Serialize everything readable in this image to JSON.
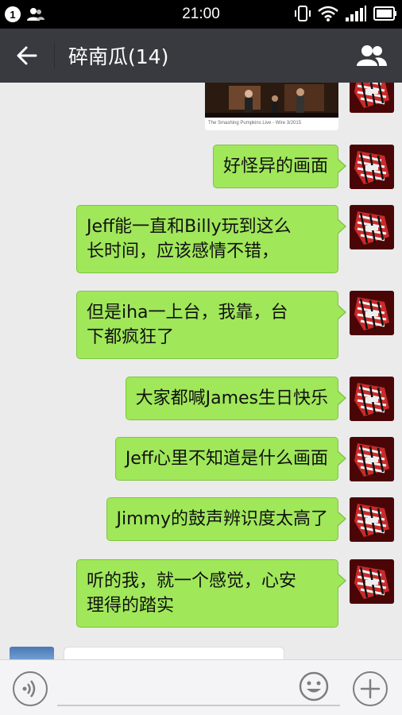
{
  "status_bar": {
    "notification_count": "1",
    "time": "21:00",
    "icons": [
      "notification-badge-icon",
      "contacts-icon",
      "vibrate-icon",
      "wifi-icon",
      "signal-icon",
      "battery-icon"
    ]
  },
  "header": {
    "back_icon": "arrow-left-icon",
    "title": "碎南瓜(14)",
    "members_icon": "group-members-icon"
  },
  "chat": {
    "image_message": {
      "caption": "The Smashing Pumpkins Live - Wire 3/2015"
    },
    "messages": [
      {
        "text_lines": [
          "好怪异的画面"
        ]
      },
      {
        "text_lines": [
          "Jeff能一直和Billy玩到这么",
          "长时间，应该感情不错，"
        ]
      },
      {
        "text_lines": [
          "但是iha一上台，我靠，台",
          "下都疯狂了"
        ]
      },
      {
        "text_lines": [
          "大家都喊James生日快乐"
        ]
      },
      {
        "text_lines": [
          "Jeff心里不知道是什么画面"
        ]
      },
      {
        "text_lines": [
          "Jimmy的鼓声辨识度太高了"
        ]
      },
      {
        "text_lines": [
          "听的我，就一个感觉，心安",
          "理得的踏实"
        ]
      }
    ]
  },
  "input_bar": {
    "voice_icon": "voice-icon",
    "emoji_icon": "emoji-icon",
    "plus_icon": "plus-icon",
    "text_value": ""
  },
  "colors": {
    "header_bg": "#393a3f",
    "status_bg": "#000000",
    "chat_bg": "#ebebeb",
    "bubble_green": "#a0e75a",
    "input_bar_bg": "#f4f4f6"
  }
}
